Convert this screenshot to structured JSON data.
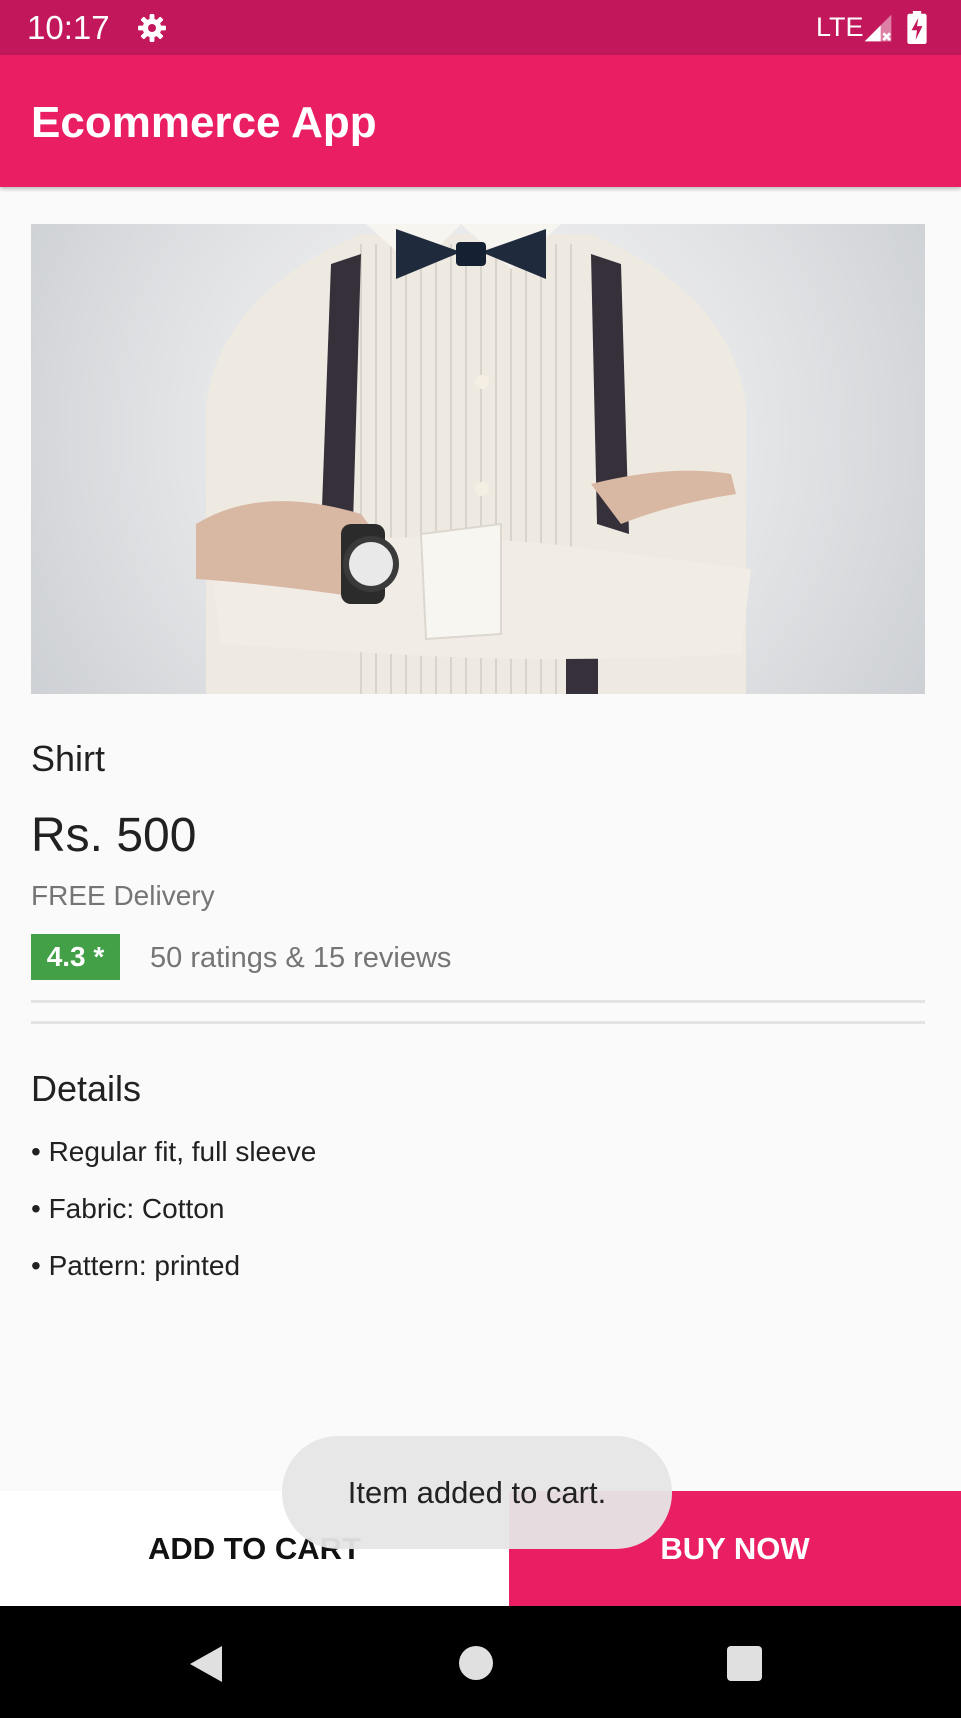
{
  "status_bar": {
    "time": "10:17",
    "network": "LTE",
    "icons": [
      "settings-gear-icon",
      "signal-icon",
      "battery-charging-icon"
    ]
  },
  "app_bar": {
    "title": "Ecommerce App"
  },
  "product": {
    "image_icon": "product-photo",
    "name": "Shirt",
    "price": "Rs. 500",
    "delivery": "FREE Delivery",
    "rating": "4.3 *",
    "rating_summary": "50 ratings & 15 reviews"
  },
  "details": {
    "heading": "Details",
    "items": [
      "• Regular fit, full sleeve",
      "• Fabric: Cotton",
      "• Pattern: printed"
    ]
  },
  "actions": {
    "add_to_cart": "ADD TO CART",
    "buy_now": "BUY NOW"
  },
  "toast": {
    "message": "Item added to cart."
  },
  "nav_bar": {
    "icons": [
      "back-icon",
      "home-icon",
      "recents-icon"
    ]
  },
  "colors": {
    "primary": "#e91e63",
    "primary_dark": "#c2185b",
    "rating_green": "#43a047",
    "background": "#fafafa"
  }
}
